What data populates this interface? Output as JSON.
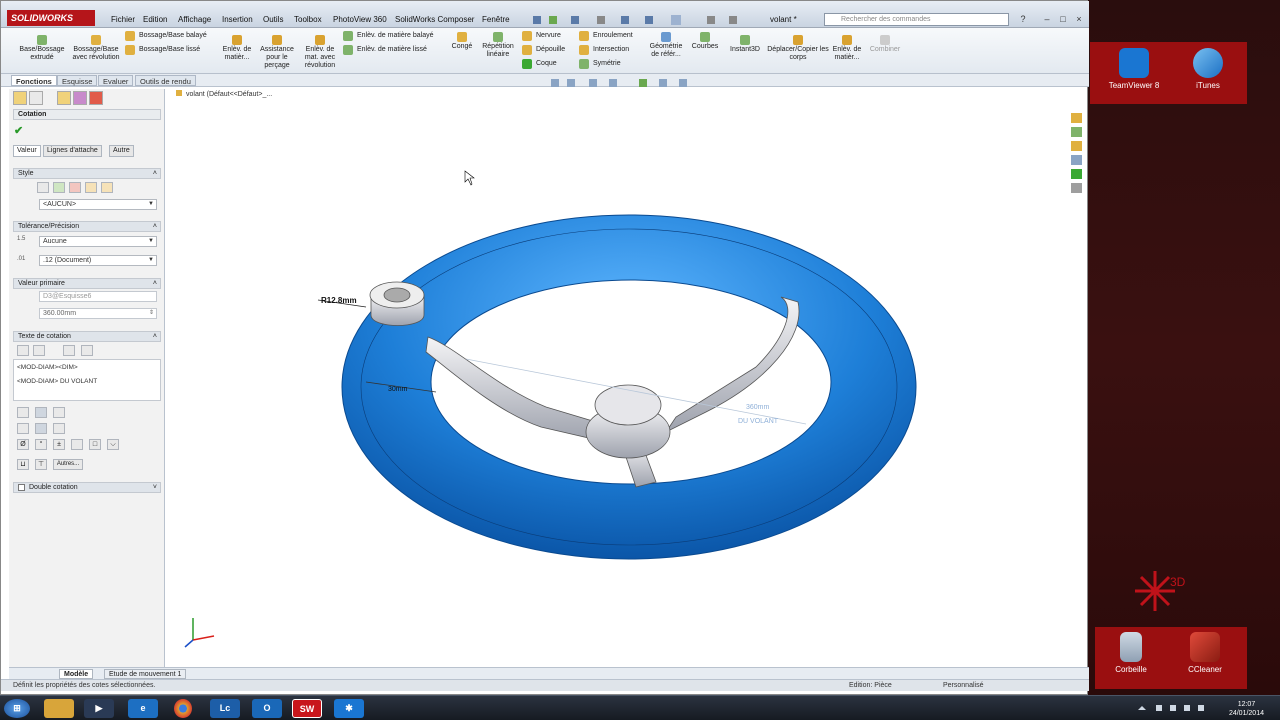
{
  "app": {
    "logo_text": "SOLIDWORKS",
    "document_title": "volant *",
    "search_placeholder": "Rechercher des commandes"
  },
  "menu": [
    "Fichier",
    "Edition",
    "Affichage",
    "Insertion",
    "Outils",
    "Toolbox",
    "PhotoView 360",
    "SolidWorks Composer",
    "Fenêtre"
  ],
  "ribbon": {
    "extrude": "Base/Bossage extrudé",
    "revolve": "Bossage/Base avec révolution",
    "sweep": "Bossage/Base balayé",
    "loft": "Bossage/Base lissé",
    "cut_extrude": "Enlèv. de matièr...",
    "hole_wizard": "Assistance pour le perçage",
    "cut_revolve": "Enlèv. de mat. avec révolution",
    "cut_sweep": "Enlèv. de matière balayé",
    "cut_loft": "Enlèv. de matière lissé",
    "fillet": "Congé",
    "pattern": "Répétition linéaire",
    "rib": "Nervure",
    "draft": "Dépouille",
    "shell": "Coque",
    "wrap": "Enroulement",
    "intersect": "Intersection",
    "mirror": "Symétrie",
    "ref_geometry": "Géométrie de référ...",
    "curves": "Courbes",
    "instant3d": "Instant3D",
    "move_copy": "Déplacer/Copier les corps",
    "cut2": "Enlèv. de matièr...",
    "combine": "Combiner"
  },
  "command_tabs": [
    "Fonctions",
    "Esquisse",
    "Evaluer",
    "Outils de rendu"
  ],
  "feature_tree_label": "volant  (Défaut<<Défaut>_...",
  "property_manager": {
    "title": "Cotation",
    "subtabs": [
      "Valeur",
      "Lignes d'attache",
      "Autre"
    ],
    "style_header": "Style",
    "style_value": "<AUCUN>",
    "tolerance_header": "Tolérance/Précision",
    "tolerance_value": "Aucune",
    "precision_value": ".12 (Document)",
    "primary_header": "Valeur primaire",
    "primary_name": "D3@Esquisse6",
    "primary_value": "360.00mm",
    "text_header": "Texte de cotation",
    "text_line1": "<MOD-DIAM><DIM>",
    "text_line2": "<MOD-DIAM> DU VOLANT",
    "others_button": "Autres...",
    "dual_header": "Double cotation"
  },
  "model": {
    "dim_radius": "R12.8mm",
    "dim_small": "30mm",
    "dim_diam_ghost": "360mm",
    "dim_ghost_text": "DU VOLANT"
  },
  "bottom_tabs": [
    "Modèle",
    "Etude de mouvement 1"
  ],
  "status": {
    "hint": "Définit les propriétés des cotes sélectionnées.",
    "mode": "Edition: Pièce",
    "custom": "Personnalisé"
  },
  "desktop_icons": [
    {
      "label": "TeamViewer 8"
    },
    {
      "label": "iTunes"
    },
    {
      "label": "Corbeille"
    },
    {
      "label": "CCleaner"
    }
  ],
  "clock": {
    "time": "12:07",
    "date": "24/01/2014"
  },
  "colors": {
    "accent": "#b5151a",
    "wheel": "#1e7fd8"
  }
}
